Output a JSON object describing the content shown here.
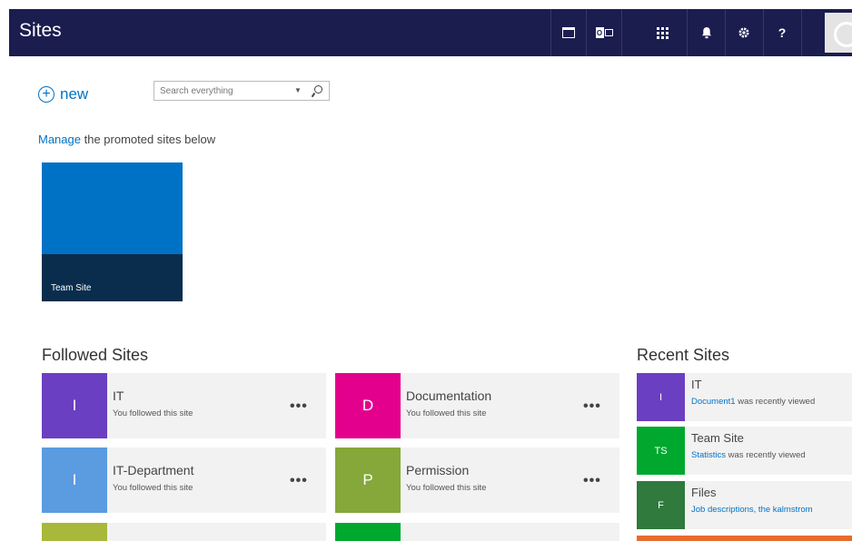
{
  "header": {
    "title": "Sites",
    "icons": [
      "calendar-icon",
      "outlook-icon",
      "app-launcher-icon",
      "notifications-icon",
      "settings-icon",
      "help-icon",
      "avatar"
    ],
    "help_label": "?",
    "outlook_label": "O"
  },
  "toolbar": {
    "new_label": "new",
    "new_glyph": "+",
    "search_placeholder": "Search everything",
    "dropdown_glyph": "▼"
  },
  "manage": {
    "link": "Manage",
    "text": " the promoted sites below"
  },
  "promoted": [
    {
      "label": "Team Site",
      "color": "#0072c6",
      "band_color": "#0a2d4d"
    }
  ],
  "followed": {
    "title": "Followed Sites",
    "more_glyph": "•••",
    "items": [
      {
        "initial": "I",
        "name": "IT",
        "sub": "You followed this site",
        "color": "#6b3fc1"
      },
      {
        "initial": "D",
        "name": "Documentation",
        "sub": "You followed this site",
        "color": "#e3008c"
      },
      {
        "initial": "I",
        "name": "IT-Department",
        "sub": "You followed this site",
        "color": "#5b9be0"
      },
      {
        "initial": "P",
        "name": "Permission",
        "sub": "You followed this site",
        "color": "#86a73a"
      },
      {
        "initial": "",
        "name": "",
        "sub": "",
        "color": "#a8b83a"
      },
      {
        "initial": "",
        "name": "",
        "sub": "",
        "color": "#00a82d"
      }
    ]
  },
  "recent": {
    "title": "Recent Sites",
    "items": [
      {
        "initial": "I",
        "name": "IT",
        "link": "Document1",
        "text": " was recently viewed",
        "color": "#6b3fc1"
      },
      {
        "initial": "TS",
        "name": "Team Site",
        "link": "Statistics",
        "text": " was recently viewed",
        "color": "#00a82d"
      },
      {
        "initial": "F",
        "name": "Files",
        "link": "Job descriptions, the kalmstrom",
        "text": "",
        "color": "#2f7a3c"
      }
    ]
  }
}
